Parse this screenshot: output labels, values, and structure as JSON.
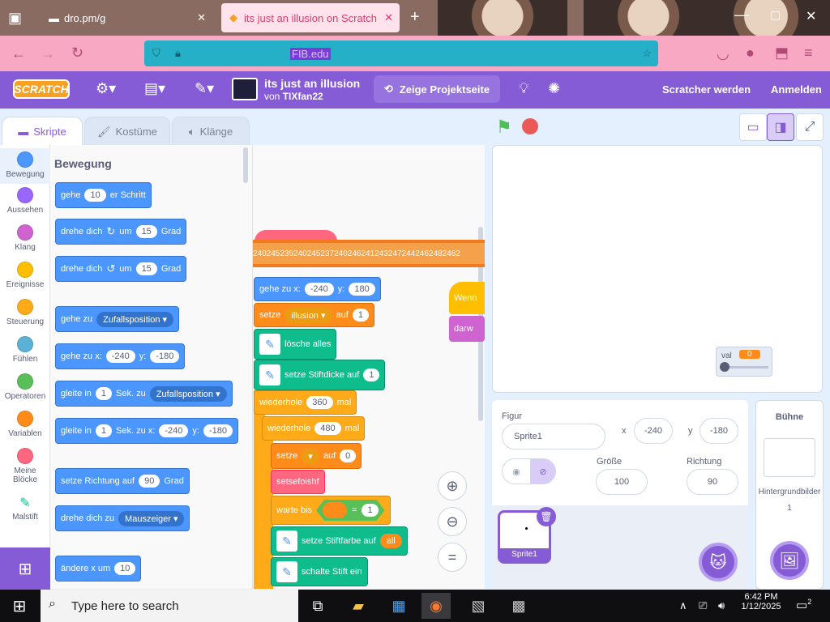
{
  "browser": {
    "tab1_title": "dro.pm/g",
    "tab2_title": "its just an illusion on Scratch",
    "new_tab_icon": "plus-icon",
    "url_highlight": "FIB.edu"
  },
  "menubar": {
    "logo": "SCRATCH",
    "project_title": "its just an illusion",
    "by_prefix": "von",
    "author": "TIXfan22",
    "project_page_button": "Zeige Projektseite",
    "join_link": "Scratcher werden",
    "signin_link": "Anmelden"
  },
  "editor_tabs": {
    "code": "Skripte",
    "costumes": "Kostüme",
    "sounds": "Klänge"
  },
  "categories": [
    {
      "label": "Bewegung",
      "color": "#4c97ff"
    },
    {
      "label": "Aussehen",
      "color": "#9966ff"
    },
    {
      "label": "Klang",
      "color": "#cf63cf"
    },
    {
      "label": "Ereignisse",
      "color": "#ffbf00"
    },
    {
      "label": "Steuerung",
      "color": "#ffab19"
    },
    {
      "label": "Fühlen",
      "color": "#5cb1d6"
    },
    {
      "label": "Operatoren",
      "color": "#59c059"
    },
    {
      "label": "Variablen",
      "color": "#ff8c1a"
    },
    {
      "label": "Meine Blöcke",
      "color": "#ff6680"
    },
    {
      "label": "Malstift",
      "color": "#0fbd8c"
    }
  ],
  "palette": {
    "heading": "Bewegung",
    "blocks": {
      "move": {
        "a": "gehe",
        "n": "10",
        "b": "er Schritt"
      },
      "turn_right": {
        "a": "drehe dich",
        "b": "um",
        "n": "15",
        "c": "Grad"
      },
      "turn_left": {
        "a": "drehe dich",
        "b": "um",
        "n": "15",
        "c": "Grad"
      },
      "goto": {
        "a": "gehe zu",
        "dd": "Zufallsposition"
      },
      "goto_xy": {
        "a": "gehe zu x:",
        "x": "-240",
        "b": "y:",
        "y": "-180"
      },
      "glide_to": {
        "a": "gleite in",
        "n": "1",
        "b": "Sek. zu",
        "dd": "Zufallsposition"
      },
      "glide_xy": {
        "a": "gleite in",
        "n": "1",
        "b": "Sek. zu x:",
        "x": "-240",
        "c": "y:",
        "y": "-180"
      },
      "point_dir": {
        "a": "setze Richtung auf",
        "n": "90",
        "b": "Grad"
      },
      "point_towards": {
        "a": "drehe dich zu",
        "dd": "Mauszeiger"
      },
      "change_x": {
        "a": "ändere x um",
        "n": "10"
      }
    }
  },
  "scripts": {
    "overflow_text": "2402452352402452372402462412432472442462482462",
    "goto_xy": {
      "a": "gehe zu x:",
      "x": "-240",
      "b": "y:",
      "y": "180"
    },
    "set_var": {
      "a": "setze",
      "dd": "illusion",
      "b": "auf",
      "n": "1"
    },
    "clear": "lösche alles",
    "pen_size": {
      "a": "setze Stiftdicke auf",
      "n": "1"
    },
    "repeat_outer": {
      "a": "wiederhole",
      "n": "360",
      "b": "mal"
    },
    "repeat_inner": {
      "a": "wiederhole",
      "n": "480",
      "b": "mal"
    },
    "set_var2": {
      "a": "setze",
      "dd": "",
      "b": "auf",
      "n": "0"
    },
    "custom_block": "setsefoishf",
    "wait_until": {
      "a": "warte bis",
      "eq": "=",
      "n": "1"
    },
    "pen_color": {
      "a": "setze Stiftfarbe auf",
      "v": "all"
    },
    "pen_down": "schalte Stift ein",
    "right_hat": "Wenn",
    "right_sound": "darw"
  },
  "stage": {
    "monitor_label": "val",
    "monitor_value": "0",
    "slider_fraction": 0.0
  },
  "sprite_info": {
    "sprite_label": "Figur",
    "sprite_name": "Sprite1",
    "x_label": "x",
    "x_value": "-240",
    "y_label": "y",
    "y_value": "-180",
    "size_label": "Größe",
    "size_value": "100",
    "dir_label": "Richtung",
    "dir_value": "90",
    "thumb_name": "Sprite1"
  },
  "stage_pane": {
    "title": "Bühne",
    "backdrops_label": "Hintergrundbilder",
    "backdrops_count": "1"
  },
  "taskbar": {
    "search_placeholder": "Type here to search",
    "time": "6:42 PM",
    "date": "1/12/2025",
    "notif_count": "2"
  }
}
